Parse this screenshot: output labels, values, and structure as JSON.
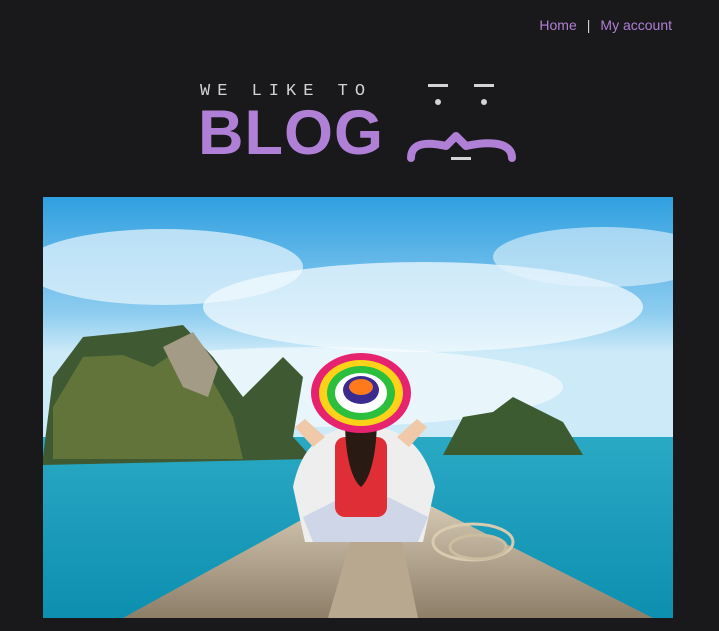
{
  "nav": {
    "home_label": "Home",
    "separator": "|",
    "account_label": "My account"
  },
  "logo": {
    "tagline": "WE LIKE TO",
    "wordmark": "BLOG",
    "colors": {
      "brand": "#b07fd6",
      "tagline": "#d4d4d4"
    }
  },
  "hero": {
    "icon": "hero-photo-traveler-boat"
  },
  "colors": {
    "background": "#19191b",
    "link": "#b07fd6"
  }
}
